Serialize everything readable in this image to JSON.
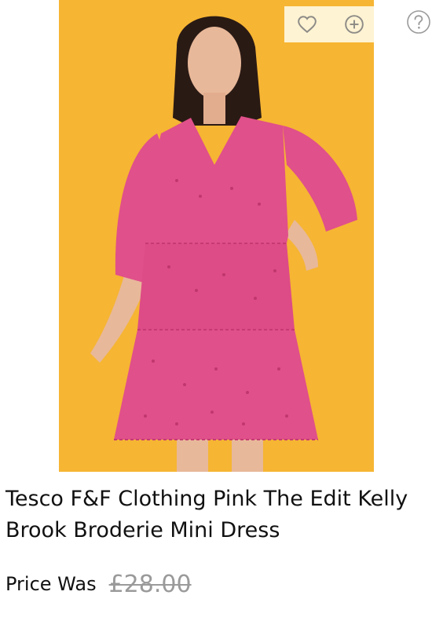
{
  "product": {
    "title": "Tesco F&F Clothing Pink The Edit Kelly Brook Broderie Mini Dress",
    "price_label": "Price Was",
    "price_was": "£28.00"
  },
  "icons": {
    "wishlist": "heart-icon",
    "add": "plus-circle-icon",
    "help": "question-icon"
  },
  "colors": {
    "image_background": "#f6b533",
    "dress": "#e0508a",
    "action_bar": "#fff6d9",
    "muted_text": "#9a9a9a"
  }
}
